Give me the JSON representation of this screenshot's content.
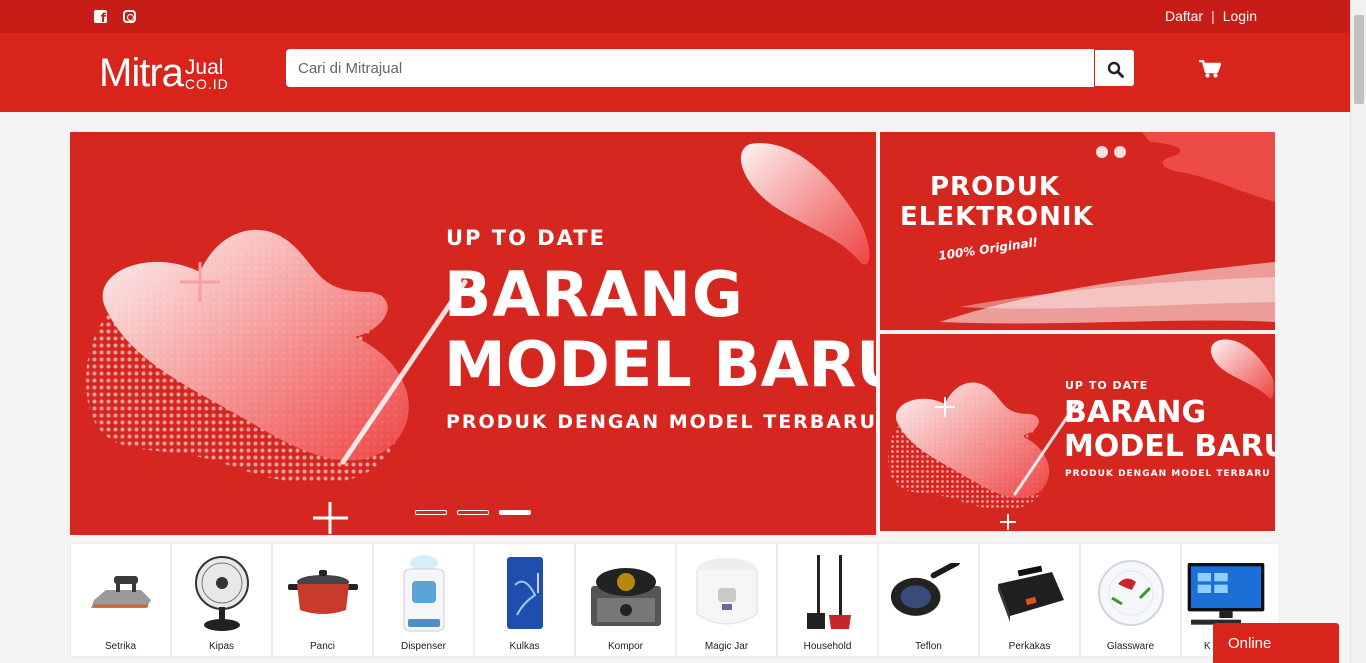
{
  "topbar": {
    "social": [
      {
        "icon": "facebook-icon"
      },
      {
        "icon": "instagram-icon"
      }
    ],
    "register_label": "Daftar",
    "separator": "|",
    "login_label": "Login"
  },
  "header": {
    "logo_main": "Mitra",
    "logo_sub_top": "Jual",
    "logo_sub_bottom": "CO.ID",
    "search_placeholder": "Cari di Mitrajual",
    "search_icon": "search-icon",
    "cart_icon": "cart-icon"
  },
  "banners": {
    "main": {
      "kicker": "UP TO DATE",
      "line1": "BARANG",
      "line2": "MODEL BARU",
      "tagline": "PRODUK DENGAN MODEL TERBARU",
      "slides_total": 3,
      "active_slide": 3
    },
    "side_top": {
      "line1": "PRODUK",
      "line2": "ELEKTRONIK",
      "tagline": "100% Original!"
    },
    "side_bottom": {
      "kicker": "UP TO DATE",
      "line1": "BARANG",
      "line2": "MODEL BARU",
      "tagline": "PRODUK DENGAN MODEL TERBARU"
    }
  },
  "categories": [
    {
      "label": "Setrika"
    },
    {
      "label": "Kipas"
    },
    {
      "label": "Panci"
    },
    {
      "label": "Dispenser"
    },
    {
      "label": "Kulkas"
    },
    {
      "label": "Kompor"
    },
    {
      "label": "Magic Jar"
    },
    {
      "label": "Household"
    },
    {
      "label": "Teflon"
    },
    {
      "label": "Perkakas"
    },
    {
      "label": "Glassware"
    },
    {
      "label": "K"
    }
  ],
  "chat": {
    "label": "Online"
  },
  "colors": {
    "brand": "#d9241c",
    "topbar": "#c81d16",
    "banner": "#d62620"
  }
}
